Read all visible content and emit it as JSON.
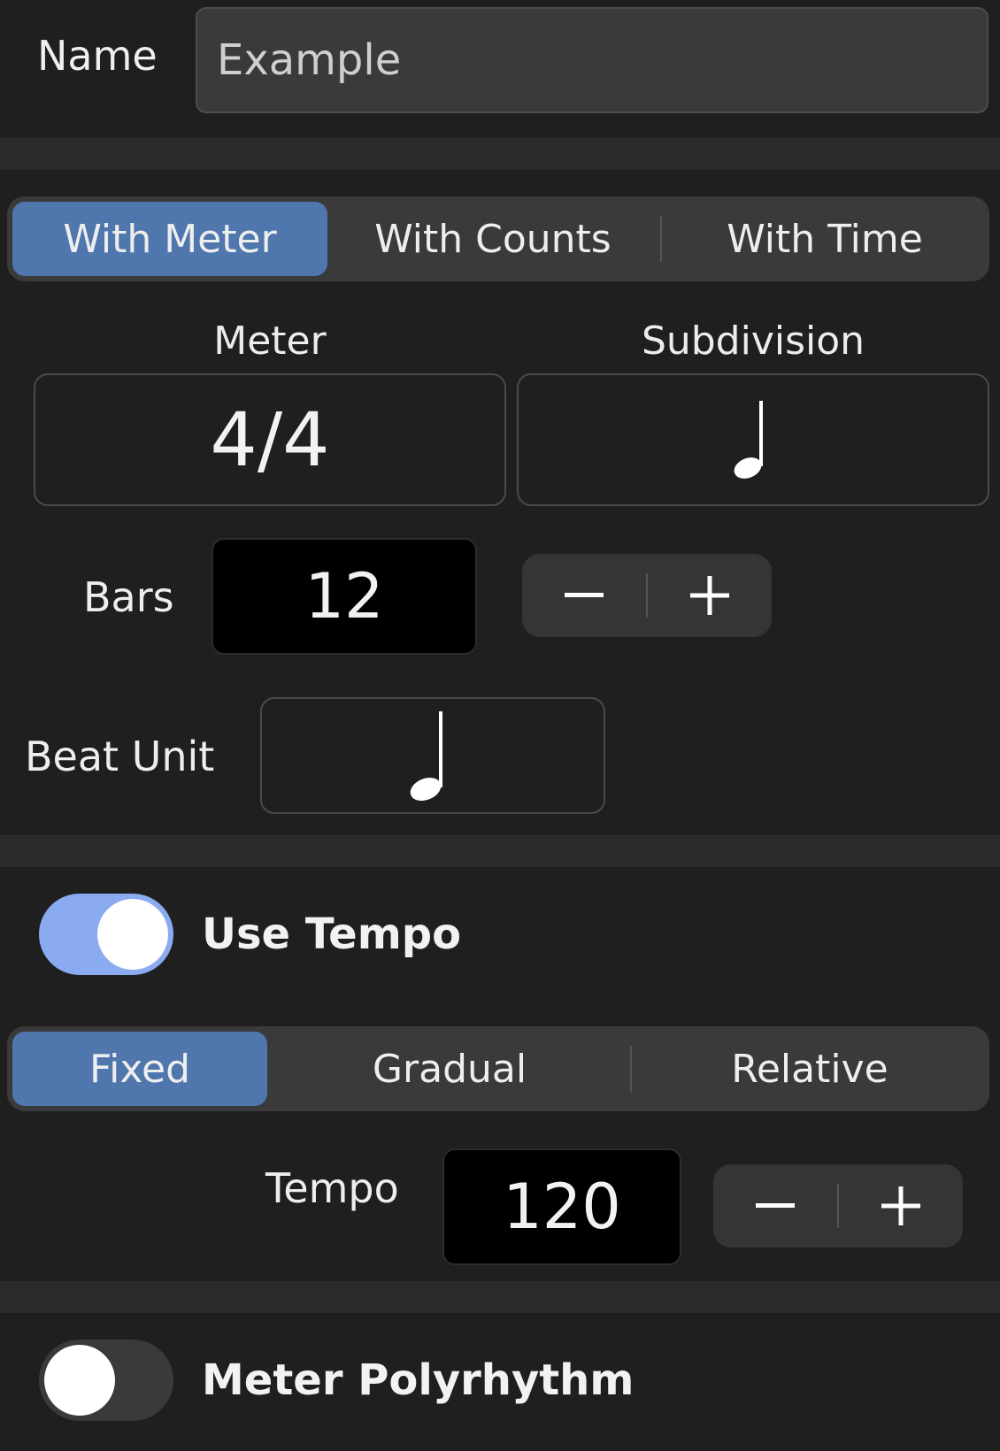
{
  "name": {
    "label": "Name",
    "value": "Example"
  },
  "mode_tabs": [
    {
      "label": "With Meter",
      "active": true
    },
    {
      "label": "With Counts",
      "active": false
    },
    {
      "label": "With Time",
      "active": false
    }
  ],
  "meter": {
    "label": "Meter",
    "value": "4/4"
  },
  "subdivision": {
    "label": "Subdivision",
    "note_icon": "quarter-note-icon"
  },
  "bars": {
    "label": "Bars",
    "value": "12"
  },
  "beat_unit": {
    "label": "Beat Unit",
    "note_icon": "half-note-icon"
  },
  "use_tempo": {
    "label": "Use Tempo",
    "on": true
  },
  "tempo_tabs": [
    {
      "label": "Fixed",
      "active": true
    },
    {
      "label": "Gradual",
      "active": false
    },
    {
      "label": "Relative",
      "active": false
    }
  ],
  "tempo": {
    "label": "Tempo",
    "value": "120"
  },
  "meter_polyrhythm": {
    "label": "Meter Polyrhythm",
    "on": false
  },
  "colors": {
    "accent": "#4f76ad",
    "toggle_on": "#8aabf0",
    "toggle_off": "#3a3a3a",
    "background": "#1f1f1f"
  }
}
